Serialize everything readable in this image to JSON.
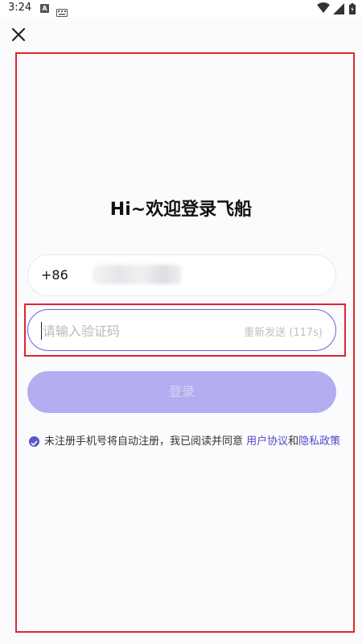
{
  "status_bar": {
    "time": "3:24",
    "notification_letter": "A"
  },
  "header": {
    "close_icon": "close-icon"
  },
  "title": "Hi~欢迎登录飞船",
  "phone": {
    "country_code": "+86"
  },
  "code": {
    "placeholder": "请输入验证码",
    "value": "",
    "resend_label": "重新发送 (117s)"
  },
  "login": {
    "label": "登录"
  },
  "agreement": {
    "prefix": "未注册手机号将自动注册，我已阅读并同意 ",
    "terms_link": "用户协议",
    "conjunction": "和",
    "privacy_link": "隐私政策",
    "checked": true
  },
  "colors": {
    "accent": "#5c56c9",
    "button_disabled": "#b3aef0",
    "highlight": "#e0262c"
  }
}
